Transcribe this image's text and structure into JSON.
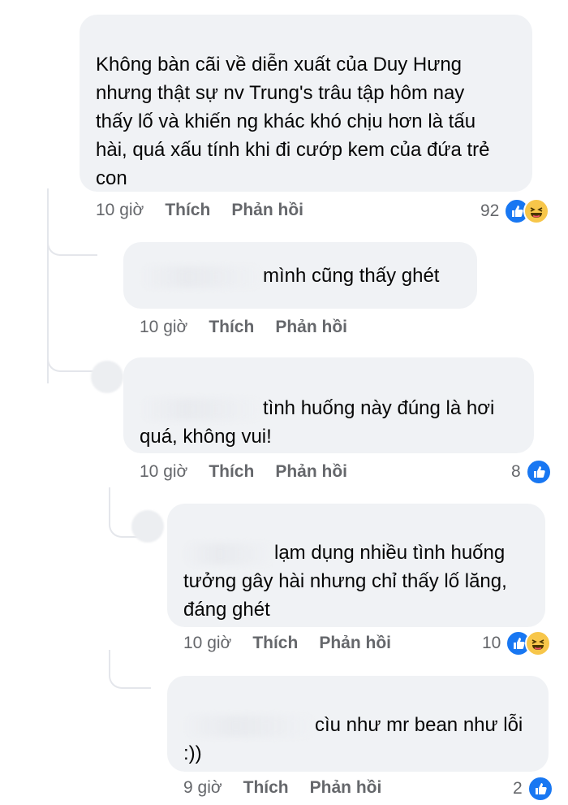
{
  "comments": [
    {
      "text": "Không bàn cãi về diễn xuất của Duy Hưng nhưng thật sự nv Trung's trâu tập hôm nay thấy lố và khiến ng khác khó chịu hơn là tấu hài, quá xấu tính khi đi cướp kem của đứa trẻ con",
      "lines": [
        "Không bàn cãi về diễn xuất của Duy Hưng",
        "nhưng thật sự nv Trung's trâu tập hôm nay",
        "thấy lố và khiến ng khác khó chịu hơn là tấu",
        "hài, quá xấu tính khi đi cướp kem của đứa trẻ",
        "con"
      ],
      "time": "10 giờ",
      "like_label": "Thích",
      "reply_label": "Phản hồi",
      "reaction_count": "92",
      "reactions": [
        "like-icon",
        "haha-icon"
      ]
    },
    {
      "lines": [
        "mình cũng thấy ghét"
      ],
      "time": "10 giờ",
      "like_label": "Thích",
      "reply_label": "Phản hồi",
      "reaction_count": "",
      "reactions": []
    },
    {
      "lines": [
        "tình huống này đúng là hơi",
        "quá, không vui!"
      ],
      "time": "10 giờ",
      "like_label": "Thích",
      "reply_label": "Phản hồi",
      "reaction_count": "8",
      "reactions": [
        "like-icon"
      ]
    },
    {
      "lines": [
        "lạm dụng nhiều tình huống",
        "tưởng gây hài nhưng chỉ thấy lố lăng,",
        "đáng ghét"
      ],
      "time": "10 giờ",
      "like_label": "Thích",
      "reply_label": "Phản hồi",
      "reaction_count": "10",
      "reactions": [
        "like-icon",
        "haha-icon"
      ]
    },
    {
      "lines": [
        "cìu như mr bean như lỗi",
        ":))"
      ],
      "time": "9 giờ",
      "like_label": "Thích",
      "reply_label": "Phản hồi",
      "reaction_count": "2",
      "reactions": [
        "like-icon"
      ]
    }
  ],
  "colors": {
    "bubble": "#f0f2f5",
    "meta": "#65676b",
    "like": "#1877f2",
    "haha": "#f7c64a",
    "thread": "#e4e6eb"
  }
}
